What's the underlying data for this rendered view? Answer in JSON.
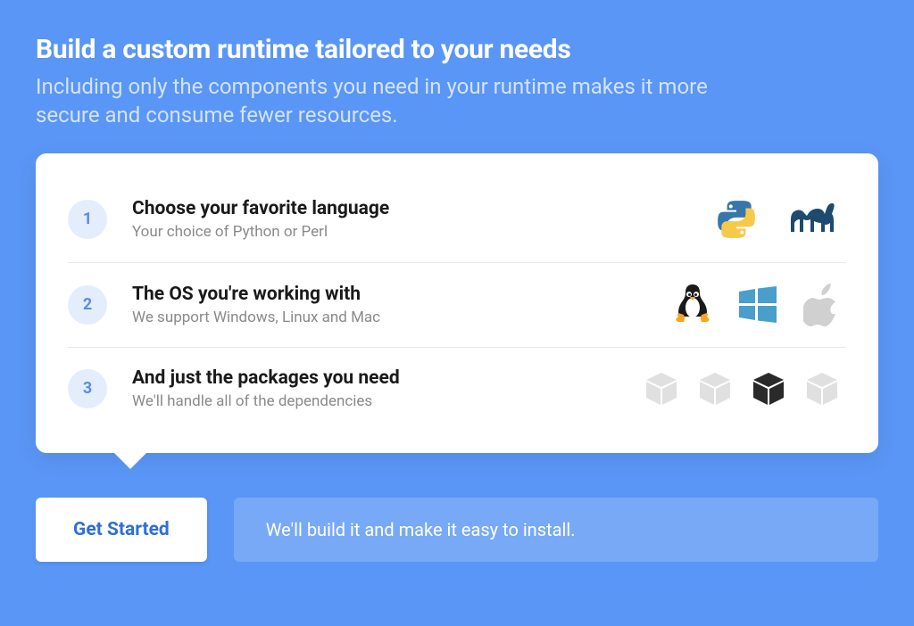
{
  "heading": "Build a custom runtime tailored to your needs",
  "subheading": "Including only the components you need in your runtime makes it more secure and consume fewer resources.",
  "steps": [
    {
      "n": "1",
      "title": "Choose your favorite language",
      "desc": "Your choice of Python or Perl"
    },
    {
      "n": "2",
      "title": "The OS you're working with",
      "desc": "We support Windows, Linux and Mac"
    },
    {
      "n": "3",
      "title": "And just the packages you need",
      "desc": "We'll handle all of the dependencies"
    }
  ],
  "cta": {
    "label": "Get Started"
  },
  "footer_note": "We'll build it and make it easy to install.",
  "colors": {
    "bg": "#5a96f5",
    "accent_blue": "#4a9ecc",
    "python_blue": "#3776ab",
    "python_yellow": "#f7c948",
    "camel": "#1d4a6e"
  }
}
